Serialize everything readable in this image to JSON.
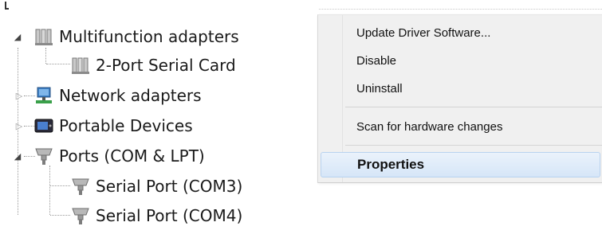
{
  "tree": {
    "items": [
      {
        "label": "Multifunction adapters",
        "icon": "multifunction-adapter-icon",
        "expanded": true
      },
      {
        "label": "2-Port Serial Card",
        "icon": "serial-card-icon"
      },
      {
        "label": "Network adapters",
        "icon": "network-adapter-icon",
        "expanded": false
      },
      {
        "label": "Portable Devices",
        "icon": "portable-device-icon",
        "expanded": false
      },
      {
        "label": "Ports (COM & LPT)",
        "icon": "port-connector-icon",
        "expanded": true
      },
      {
        "label": "Serial Port (COM3)",
        "icon": "port-connector-icon"
      },
      {
        "label": "Serial Port (COM4)",
        "icon": "port-connector-icon"
      }
    ]
  },
  "context_menu": {
    "items": [
      {
        "label": "Update Driver Software..."
      },
      {
        "label": "Disable"
      },
      {
        "label": "Uninstall"
      },
      {
        "label": "Scan for hardware changes"
      },
      {
        "label": "Properties",
        "default": true
      }
    ]
  },
  "colors": {
    "highlight": "#d6e6f8",
    "highlight_border": "#b8d2ef",
    "menu_background": "#f0f0f0"
  }
}
